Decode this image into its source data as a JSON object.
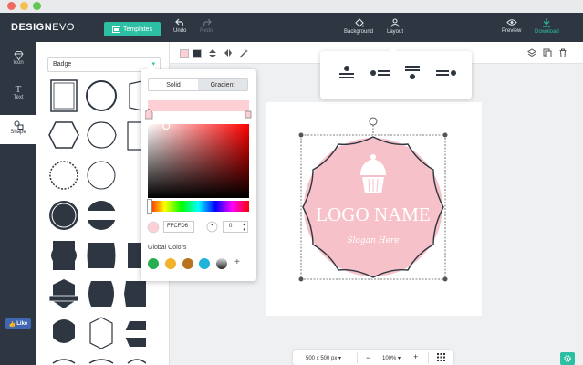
{
  "topbar": {
    "logo_design": "DESIGN",
    "logo_evo": "EVO",
    "templates_label": "Templates",
    "undo_label": "Undo",
    "redo_label": "Redo",
    "background_label": "Background",
    "layout_label": "Layout",
    "preview_label": "Preview",
    "download_label": "Download"
  },
  "sidebar": {
    "items": [
      {
        "label": "Icon",
        "icon": "diamond-icon"
      },
      {
        "label": "Text",
        "icon": "text-icon"
      },
      {
        "label": "Shape",
        "icon": "shapes-icon"
      }
    ],
    "fb_like": "Like"
  },
  "panel": {
    "category_selected": "Badge"
  },
  "picker": {
    "tab_solid": "Solid",
    "tab_gradient": "Gradient",
    "hex_value": "FFCFD6",
    "opacity_value": "0",
    "global_colors_label": "Global Colors",
    "global_colors": [
      "#27ae4f",
      "#f2b32a",
      "#b8731f",
      "#1fb3d9",
      "#444444"
    ],
    "add_symbol": "+"
  },
  "logo": {
    "name": "LOGO NAME",
    "slogan": "Slogan Here"
  },
  "bottombar": {
    "size_label": "500 x 500 px",
    "minus": "−",
    "zoom": "100%",
    "plus": "+"
  },
  "colors": {
    "dark": "#2d3641",
    "accent": "#2cbfa3",
    "badge_pink": "#f7c1c9"
  }
}
